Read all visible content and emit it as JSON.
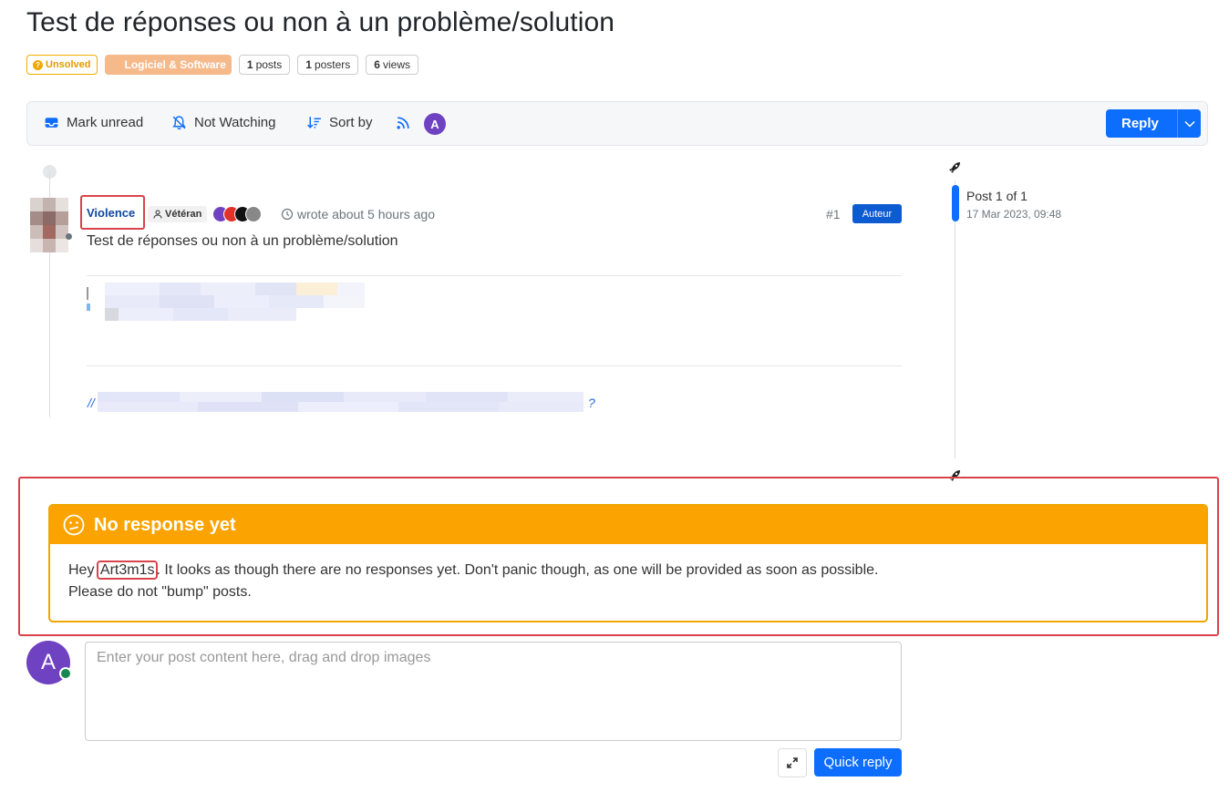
{
  "topic": {
    "title": "Test de réponses ou non à un problème/solution",
    "status": "Unsolved",
    "category": "Logiciel & Software",
    "posts_count": "1",
    "posts_label": "posts",
    "posters_count": "1",
    "posters_label": "posters",
    "views_count": "6",
    "views_label": "views"
  },
  "toolbar": {
    "mark_unread": "Mark unread",
    "not_watching": "Not Watching",
    "sort_by": "Sort by",
    "user_initial": "A",
    "reply": "Reply"
  },
  "post": {
    "username": "Violence",
    "rank": "Vétéran",
    "wrote": "wrote about 5 hours ago",
    "number": "#1",
    "author_badge": "Auteur",
    "content": "Test de réponses ou non à un problème/solution",
    "quote_start": "//",
    "quote_end": "?"
  },
  "sidebar": {
    "post_position": "Post 1 of 1",
    "date": "17 Mar 2023, 09:48"
  },
  "alert": {
    "heading": "No response yet",
    "greeting": "Hey",
    "user": "Art3m1s",
    "message": ". It looks as though there are no responses yet. Don't panic though, as one will be provided as soon as possible.",
    "line2": "Please do not \"bump\" posts."
  },
  "composer": {
    "avatar_initial": "A",
    "placeholder": "Enter your post content here, drag and drop images",
    "quick_reply": "Quick reply"
  },
  "colors": {
    "primary": "#0d6efd",
    "warning": "#fba300",
    "unsolved": "#f0ad00",
    "category": "#f6b98a",
    "highlight": "#d9434b",
    "avatar": "#6f42c1"
  }
}
